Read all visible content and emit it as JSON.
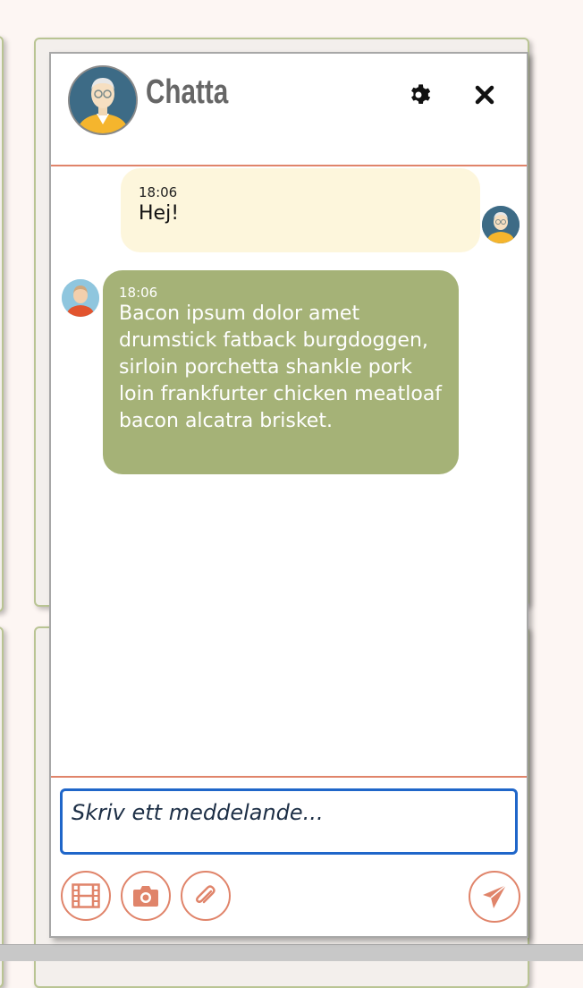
{
  "header": {
    "title": "Chatta",
    "settings_icon": "gear-icon",
    "close_icon": "close-icon"
  },
  "messages": [
    {
      "time": "18:06",
      "text": "Hej!",
      "direction": "outgoing"
    },
    {
      "time": "18:06",
      "text": "Bacon ipsum dolor amet drumstick fatback burgdoggen, sirloin porchetta shankle pork loin frankfurter chicken meatloaf bacon alcatra brisket.",
      "direction": "incoming"
    }
  ],
  "composer": {
    "placeholder": "Skriv ett meddelande...",
    "value": "",
    "buttons": [
      "film-icon",
      "camera-icon",
      "paperclip-icon",
      "send-icon"
    ]
  },
  "colors": {
    "accent": "#e0846a",
    "outgoing_bubble": "#fdf6dc",
    "incoming_bubble": "#a5b277",
    "input_focus": "#1f66c9"
  }
}
